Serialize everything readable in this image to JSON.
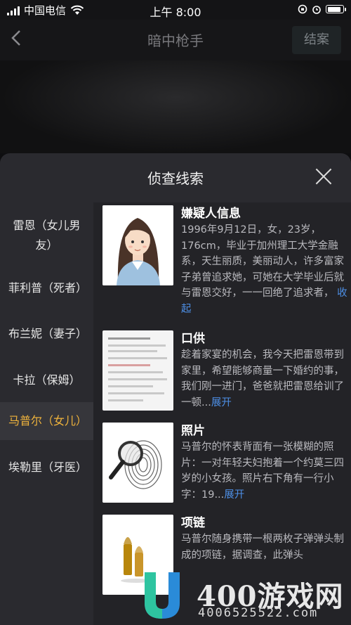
{
  "status_bar": {
    "carrier": "中国电信",
    "time": "上午 8:00",
    "battery_level": 0.9
  },
  "nav": {
    "title": "暗中枪手",
    "close_case_label": "结案",
    "back_icon": "chevron-left-icon"
  },
  "sheet": {
    "title": "侦查线索",
    "close_icon": "close-icon"
  },
  "sidebar": {
    "items": [
      {
        "label": "雷恩（女儿男友）",
        "active": false
      },
      {
        "label": "菲利普（死者）",
        "active": false
      },
      {
        "label": "布兰妮（妻子）",
        "active": false
      },
      {
        "label": "卡拉（保姆）",
        "active": false
      },
      {
        "label": "马普尔（女儿）",
        "active": true
      },
      {
        "label": "埃勒里（牙医）",
        "active": false
      }
    ],
    "active_color": "#f0b43c"
  },
  "clues": [
    {
      "title": "嫌疑人信息",
      "text": "1996年9月12日，女，23岁，176cm，毕业于加州理工大学金融系，天生丽质，美丽动人，许多富家子弟曾追求她，可她在大学毕业后就与雷恩交好，一一回绝了追求者，",
      "more": "收起",
      "image": "woman-avatar-icon"
    },
    {
      "title": "口供",
      "text": "趁着家宴的机会，我今天把雷恩带到家里，希望能够商量一下婚约的事，我们刚一进门，爸爸就把雷恩给训了一顿...",
      "more": "展开",
      "image": "document-icon"
    },
    {
      "title": "照片",
      "text": "马普尔的怀表背面有一张模糊的照片：一对年轻夫妇抱着一个约莫三四岁的小女孩。照片右下角有一行小字：19...",
      "more": "展开",
      "image": "magnifier-fingerprint-icon"
    },
    {
      "title": "项链",
      "text": "马普尔随身携带一根两枚子弹弹头制成的项链，据调查，此弹头",
      "more": "",
      "image": "bullets-icon"
    }
  ],
  "watermark": {
    "brand": "400游戏网",
    "phone": "4006525522.com"
  },
  "colors": {
    "link": "#4d8fe6",
    "sheet_bg": "#2a2a2f"
  }
}
